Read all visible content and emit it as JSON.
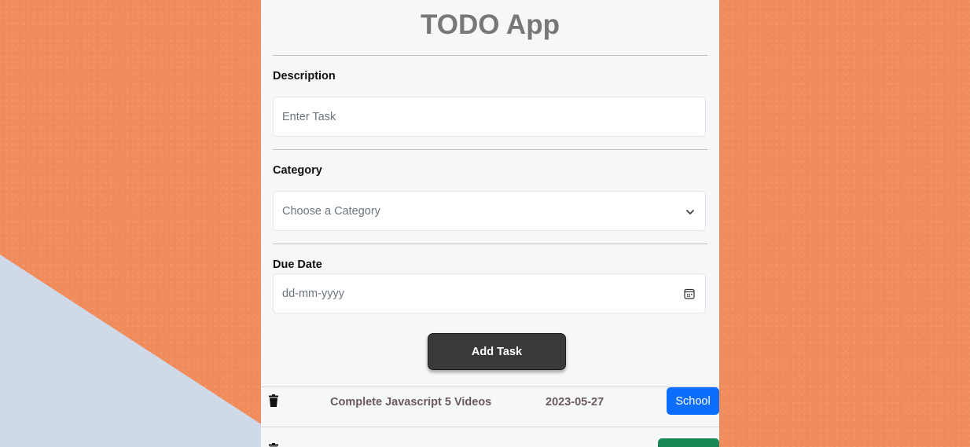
{
  "app": {
    "title": "TODO App"
  },
  "form": {
    "description_label": "Description",
    "description_placeholder": "Enter Task",
    "category_label": "Category",
    "category_placeholder": "Choose a Category",
    "due_date_label": "Due Date",
    "due_date_placeholder": "dd-mm-yyyy",
    "add_button": "Add Task"
  },
  "tasks": [
    {
      "description": "Complete Javascript 5 Videos",
      "due": "2023-05-27",
      "category": "School",
      "category_color": "#0d6efd"
    },
    {
      "description": "",
      "due": "",
      "category": "",
      "category_color": "#198754"
    }
  ],
  "colors": {
    "background": "#f08c5c",
    "panel": "#f6f7f9",
    "button": "#3b3838"
  }
}
